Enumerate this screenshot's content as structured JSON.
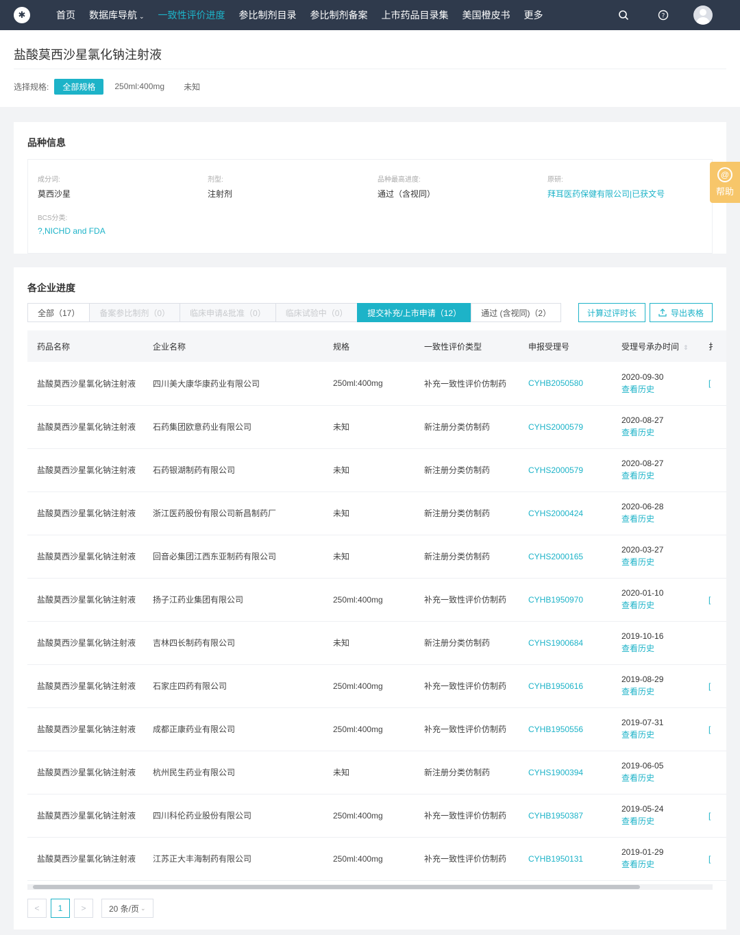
{
  "nav": {
    "items": [
      {
        "label": "首页"
      },
      {
        "label": "数据库导航",
        "caret": "⌄"
      },
      {
        "label": "一致性评价进度",
        "active": true
      },
      {
        "label": "参比制剂目录"
      },
      {
        "label": "参比制剂备案"
      },
      {
        "label": "上市药品目录集"
      },
      {
        "label": "美国橙皮书"
      },
      {
        "label": "更多"
      }
    ]
  },
  "page": {
    "title": "盐酸莫西沙星氯化钠注射液",
    "spec_label": "选择规格:",
    "spec_options": [
      "全部规格",
      "250ml:400mg",
      "未知"
    ]
  },
  "variety": {
    "title": "品种信息",
    "fields": [
      {
        "key": "成分词:",
        "value": "莫西沙星"
      },
      {
        "key": "剂型:",
        "value": "注射剂"
      },
      {
        "key": "品种最高进度:",
        "value": "通过（含视同）"
      },
      {
        "key": "原研:",
        "value": "拜耳医药保健有限公司|已获文号"
      },
      {
        "key": "BCS分类:",
        "value": "?,NICHD and FDA"
      }
    ]
  },
  "help": {
    "label": "帮助"
  },
  "progress": {
    "title": "各企业进度",
    "tabs": [
      {
        "label": "全部（17）"
      },
      {
        "label": "备案参比制剂（0）"
      },
      {
        "label": "临床申请&批准（0）"
      },
      {
        "label": "临床试验中（0）"
      },
      {
        "label": "提交补充/上市申请（12）"
      },
      {
        "label": "通过 (含视同)（2）"
      }
    ],
    "actions": {
      "calc": "计算过评时长",
      "export": "导出表格"
    },
    "columns": [
      "药品名称",
      "企业名称",
      "规格",
      "一致性评价类型",
      "申报受理号",
      "受理号承办时间",
      "扌"
    ],
    "history_label": "查看历史",
    "rows": [
      {
        "drug": "盐酸莫西沙星氯化钠注射液",
        "company": "四川美大康华康药业有限公司",
        "spec": "250ml:400mg",
        "type": "补充一致性评价仿制药",
        "no": "CYHB2050580",
        "date": "2020-09-30",
        "edge": "["
      },
      {
        "drug": "盐酸莫西沙星氯化钠注射液",
        "company": "石药集团欧意药业有限公司",
        "spec": "未知",
        "type": "新注册分类仿制药",
        "no": "CYHS2000579",
        "date": "2020-08-27",
        "edge": ""
      },
      {
        "drug": "盐酸莫西沙星氯化钠注射液",
        "company": "石药银湖制药有限公司",
        "spec": "未知",
        "type": "新注册分类仿制药",
        "no": "CYHS2000579",
        "date": "2020-08-27",
        "edge": ""
      },
      {
        "drug": "盐酸莫西沙星氯化钠注射液",
        "company": "浙江医药股份有限公司新昌制药厂",
        "spec": "未知",
        "type": "新注册分类仿制药",
        "no": "CYHS2000424",
        "date": "2020-06-28",
        "edge": ""
      },
      {
        "drug": "盐酸莫西沙星氯化钠注射液",
        "company": "回音必集团江西东亚制药有限公司",
        "spec": "未知",
        "type": "新注册分类仿制药",
        "no": "CYHS2000165",
        "date": "2020-03-27",
        "edge": ""
      },
      {
        "drug": "盐酸莫西沙星氯化钠注射液",
        "company": "扬子江药业集团有限公司",
        "spec": "250ml:400mg",
        "type": "补充一致性评价仿制药",
        "no": "CYHB1950970",
        "date": "2020-01-10",
        "edge": "["
      },
      {
        "drug": "盐酸莫西沙星氯化钠注射液",
        "company": "吉林四长制药有限公司",
        "spec": "未知",
        "type": "新注册分类仿制药",
        "no": "CYHS1900684",
        "date": "2019-10-16",
        "edge": ""
      },
      {
        "drug": "盐酸莫西沙星氯化钠注射液",
        "company": "石家庄四药有限公司",
        "spec": "250ml:400mg",
        "type": "补充一致性评价仿制药",
        "no": "CYHB1950616",
        "date": "2019-08-29",
        "edge": "["
      },
      {
        "drug": "盐酸莫西沙星氯化钠注射液",
        "company": "成都正康药业有限公司",
        "spec": "250ml:400mg",
        "type": "补充一致性评价仿制药",
        "no": "CYHB1950556",
        "date": "2019-07-31",
        "edge": "["
      },
      {
        "drug": "盐酸莫西沙星氯化钠注射液",
        "company": "杭州民生药业有限公司",
        "spec": "未知",
        "type": "新注册分类仿制药",
        "no": "CYHS1900394",
        "date": "2019-06-05",
        "edge": ""
      },
      {
        "drug": "盐酸莫西沙星氯化钠注射液",
        "company": "四川科伦药业股份有限公司",
        "spec": "250ml:400mg",
        "type": "补充一致性评价仿制药",
        "no": "CYHB1950387",
        "date": "2019-05-24",
        "edge": "["
      },
      {
        "drug": "盐酸莫西沙星氯化钠注射液",
        "company": "江苏正大丰海制药有限公司",
        "spec": "250ml:400mg",
        "type": "补充一致性评价仿制药",
        "no": "CYHB1950131",
        "date": "2019-01-29",
        "edge": "["
      }
    ]
  },
  "pagination": {
    "prev": "<",
    "current": "1",
    "next": ">",
    "page_size": "20 条/页"
  },
  "colors": {
    "accent": "#1db3c8",
    "nav_bg": "#2f3a4c",
    "help_bg": "#f7c66a"
  }
}
